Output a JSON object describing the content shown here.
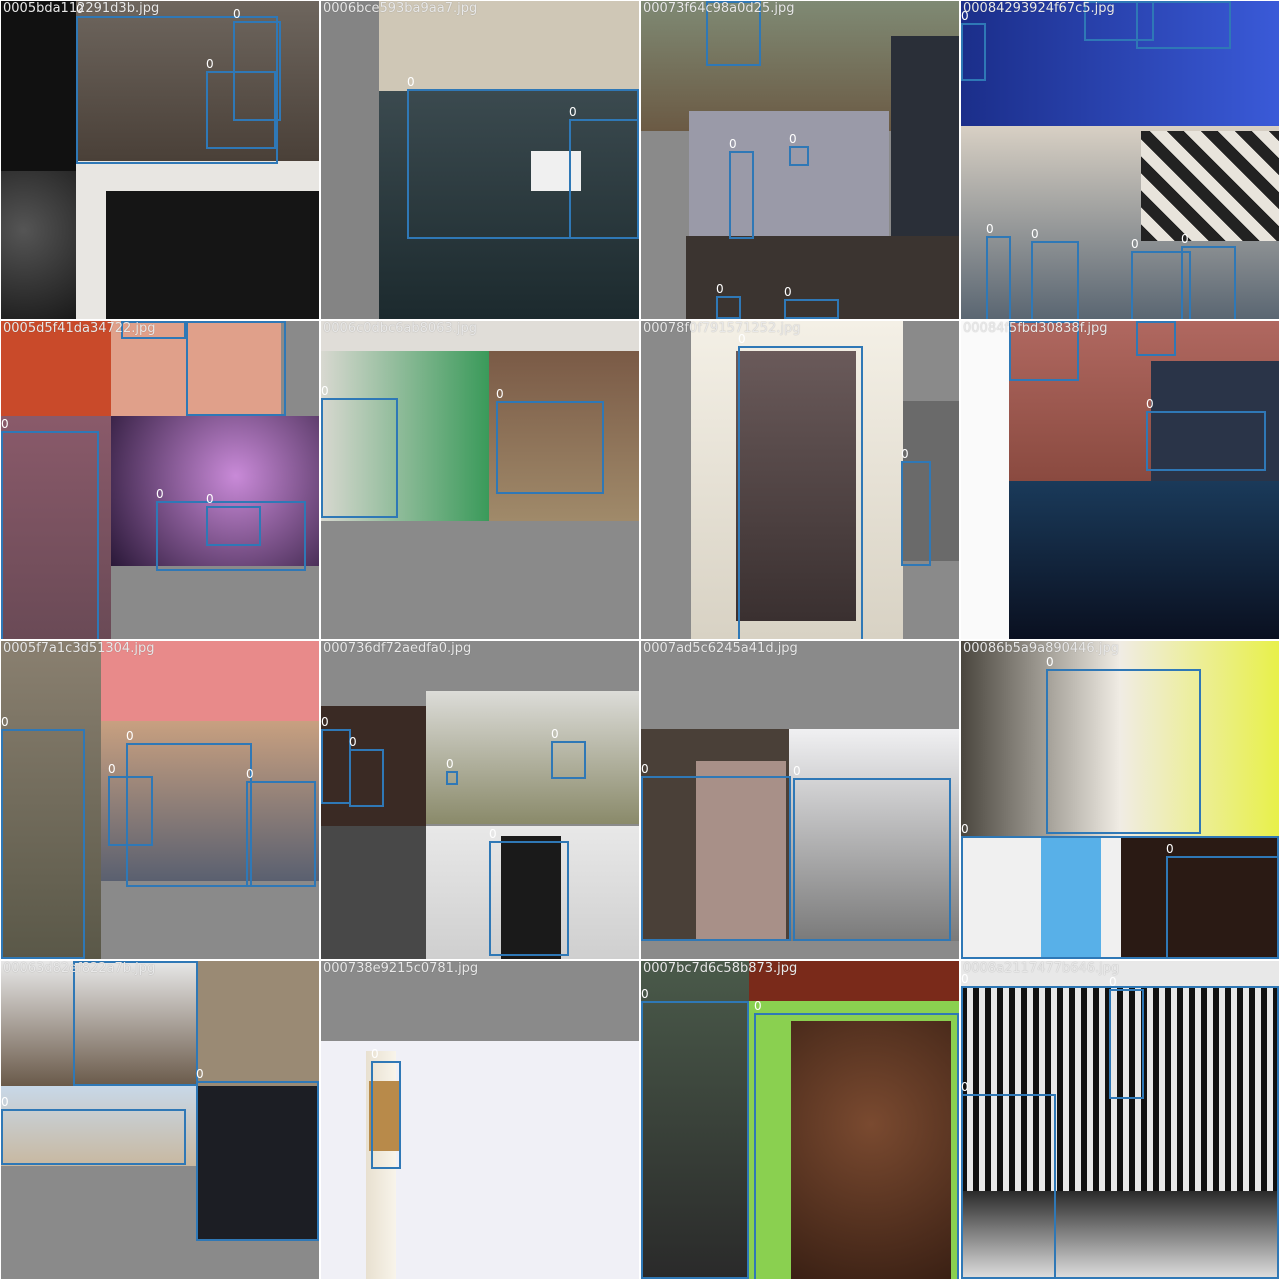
{
  "mosaic": {
    "box_color": "#2f78b6",
    "tiles": [
      {
        "filename": "0005bda112291d3b.jpg",
        "label": "0"
      },
      {
        "filename": "0006bce593ba9aa7.jpg",
        "label": "0"
      },
      {
        "filename": "00073f64c98a0d25.jpg",
        "label": "0"
      },
      {
        "filename": "00084293924f67c5.jpg",
        "label": "0"
      },
      {
        "filename": "0005d5f41da34722.jpg",
        "label": "0"
      },
      {
        "filename": "0006c0dbc6ab8063.jpg",
        "label": "0"
      },
      {
        "filename": "00078f0f791571252.jpg",
        "label": "0"
      },
      {
        "filename": "00084f5fbd30838f.jpg",
        "label": "0"
      },
      {
        "filename": "0005f7a1c3d51304.jpg",
        "label": "0"
      },
      {
        "filename": "000736df72aedfa0.jpg",
        "label": "0"
      },
      {
        "filename": "0007ad5c6245a41d.jpg",
        "label": "0"
      },
      {
        "filename": "00086b5a9a890446.jpg",
        "label": "0"
      },
      {
        "filename": "00063d82ef822a7b.jpg",
        "label": "0"
      },
      {
        "filename": "000738e9215c0781.jpg",
        "label": "0"
      },
      {
        "filename": "0007bc7d6c58b873.jpg",
        "label": "0"
      },
      {
        "filename": "0008a2117477b646.jpg",
        "label": "0"
      }
    ]
  }
}
